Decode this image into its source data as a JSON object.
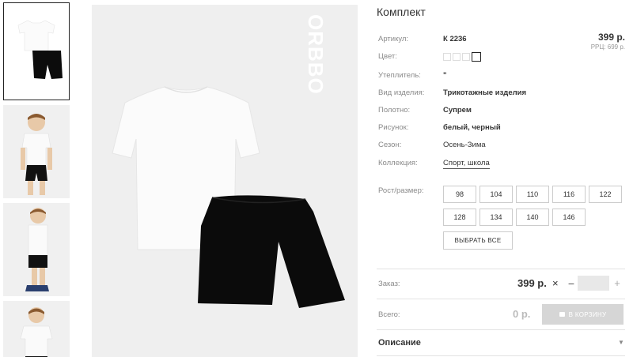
{
  "brand": "ORBBO",
  "product": {
    "title": "Комплект",
    "price": "399 р.",
    "rrp": "РРЦ: 699 р.",
    "attributes": [
      {
        "label": "Артикул:",
        "value": "К 2236",
        "style": "bold"
      },
      {
        "label": "Цвет:",
        "value": "",
        "style": "swatches"
      },
      {
        "label": "Утеплитель:",
        "value": "\"",
        "style": "bold"
      },
      {
        "label": "Вид изделия:",
        "value": "Трикотажные изделия",
        "style": "bold"
      },
      {
        "label": "Полотно:",
        "value": "Супрем",
        "style": "bold"
      },
      {
        "label": "Рисунок:",
        "value": "белый, черный",
        "style": "bold"
      },
      {
        "label": "Сезон:",
        "value": "Осень-Зима",
        "style": "normal"
      },
      {
        "label": "Коллекция:",
        "value": "Спорт, школа",
        "style": "link"
      }
    ],
    "color_swatches": 4
  },
  "sizes": {
    "label": "Рост/размер:",
    "options": [
      "98",
      "104",
      "110",
      "116",
      "122",
      "128",
      "134",
      "140",
      "146"
    ],
    "select_all": "ВЫБРАТЬ ВСЕ"
  },
  "order": {
    "label": "Заказ:",
    "price": "399 р.",
    "times": "×",
    "minus": "−",
    "plus": "+",
    "quantity": ""
  },
  "total": {
    "label": "Всего:",
    "value": "0 р.",
    "cart_button": "В КОРЗИНУ"
  },
  "description": {
    "label": "Описание",
    "arrow": "▼"
  },
  "colors": {
    "accent_disabled": "#d6d6d6",
    "text": "#333333",
    "label": "#8a8a8a"
  }
}
